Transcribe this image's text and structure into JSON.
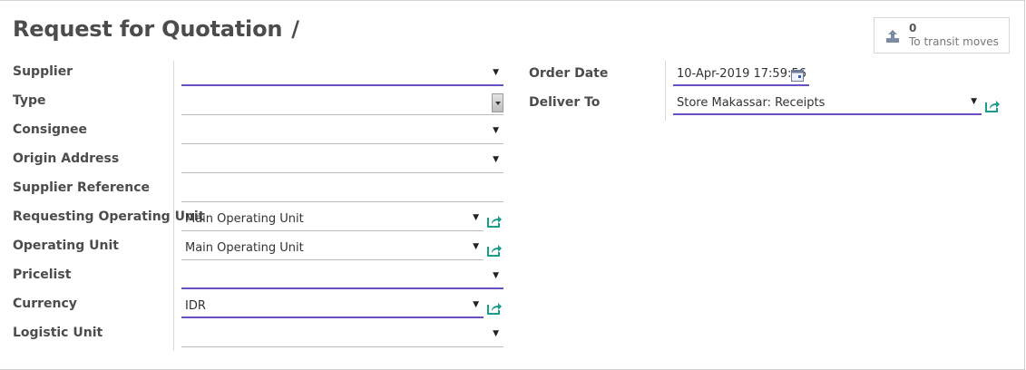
{
  "page": {
    "title": "Request for Quotation",
    "title_separator": "/"
  },
  "smart_button": {
    "count": "0",
    "label": "To transit moves",
    "icon": "upload-icon"
  },
  "left_fields": [
    {
      "label": "Supplier",
      "value": "",
      "widget": "select",
      "required": true
    },
    {
      "label": "Type",
      "value": "",
      "widget": "spin-select",
      "required": false
    },
    {
      "label": "Consignee",
      "value": "",
      "widget": "select",
      "required": false
    },
    {
      "label": "Origin Address",
      "value": "",
      "widget": "select",
      "required": false
    },
    {
      "label": "Supplier Reference",
      "value": "",
      "widget": "text",
      "required": false
    },
    {
      "label": "Requesting Operating Unit",
      "value": "Main Operating Unit",
      "widget": "select",
      "required": false,
      "external_link": true
    },
    {
      "label": "Operating Unit",
      "value": "Main Operating Unit",
      "widget": "select",
      "required": false,
      "external_link": true
    },
    {
      "label": "Pricelist",
      "value": "",
      "widget": "select",
      "required": true
    },
    {
      "label": "Currency",
      "value": "IDR",
      "widget": "select",
      "required": true,
      "external_link": true
    },
    {
      "label": "Logistic Unit",
      "value": "",
      "widget": "select",
      "required": false
    }
  ],
  "right_fields": {
    "order_date": {
      "label": "Order Date",
      "value": "10-Apr-2019 17:59:56",
      "icon": "calendar-icon"
    },
    "deliver_to": {
      "label": "Deliver To",
      "value": "Store Makassar: Receipts",
      "icon": "external-link-icon"
    }
  },
  "colors": {
    "required_underline": "#6a4fbf",
    "link_icon": "#1a9c8c"
  }
}
